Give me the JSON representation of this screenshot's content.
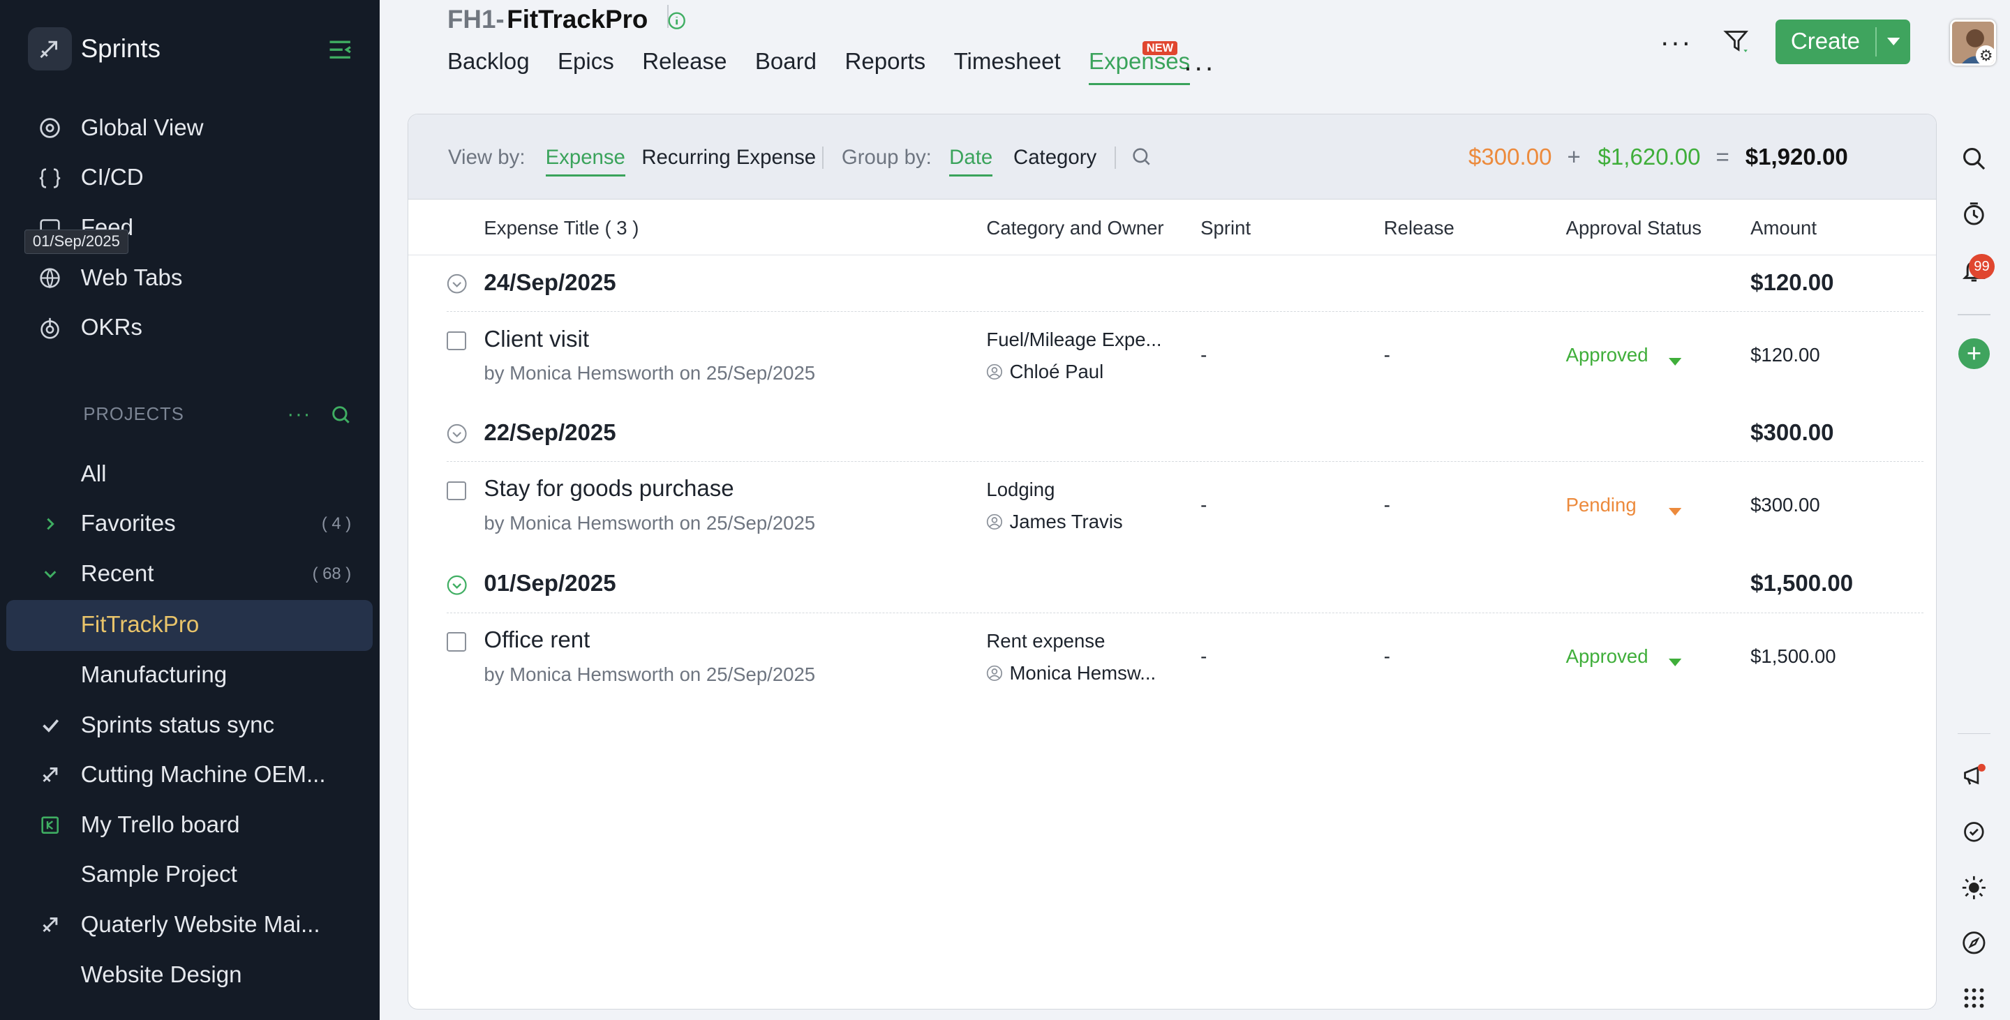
{
  "sidebar": {
    "app_name": "Sprints",
    "tooltip": "01/Sep/2025",
    "nav": [
      {
        "label": "Global View"
      },
      {
        "label": "CI/CD"
      },
      {
        "label": "Feed"
      },
      {
        "label": "Web Tabs"
      },
      {
        "label": "OKRs"
      }
    ],
    "projects_header": "PROJECTS",
    "projects_more": "···",
    "sections": [
      {
        "label": "All"
      },
      {
        "label": "Favorites",
        "count": "( 4 )"
      },
      {
        "label": "Recent",
        "count": "( 68 )"
      }
    ],
    "projects": [
      {
        "label": "FitTrackPro"
      },
      {
        "label": "Manufacturing"
      },
      {
        "label": "Sprints status sync"
      },
      {
        "label": "Cutting Machine OEM..."
      },
      {
        "label": "My Trello board"
      },
      {
        "label": "Sample Project"
      },
      {
        "label": "Quaterly Website Mai..."
      },
      {
        "label": "Website Design"
      }
    ]
  },
  "header": {
    "project_code": "FH1-",
    "project_name": "FitTrackPro",
    "tabs": [
      {
        "label": "Backlog"
      },
      {
        "label": "Epics"
      },
      {
        "label": "Release"
      },
      {
        "label": "Board"
      },
      {
        "label": "Reports"
      },
      {
        "label": "Timesheet"
      },
      {
        "label": "Expenses",
        "badge": "NEW"
      }
    ],
    "more": "···",
    "create_label": "Create"
  },
  "rail": {
    "notification_count": "99"
  },
  "toolbar": {
    "view_by_label": "View by:",
    "view_expense": "Expense",
    "view_recurring": "Recurring Expense",
    "group_by_label": "Group by:",
    "group_date": "Date",
    "group_category": "Category",
    "total_pending": "$300.00",
    "plus": "+",
    "total_approved": "$1,620.00",
    "equals": "=",
    "total_all": "$1,920.00"
  },
  "columns": {
    "title": "Expense Title ( 3 )",
    "category_owner": "Category and Owner",
    "sprint": "Sprint",
    "release": "Release",
    "approval": "Approval Status",
    "amount": "Amount"
  },
  "groups": [
    {
      "date": "24/Sep/2025",
      "total": "$120.00",
      "expense": {
        "title": "Client visit",
        "by": "by",
        "creator": "Monica Hemsworth",
        "on": "on",
        "created": "25/Sep/2025",
        "category": "Fuel/Mileage Expe...",
        "owner": "Chloé Paul",
        "sprint": "-",
        "release": "-",
        "status": "Approved",
        "amount": "$120.00"
      }
    },
    {
      "date": "22/Sep/2025",
      "total": "$300.00",
      "expense": {
        "title": "Stay for goods purchase",
        "by": "by",
        "creator": "Monica Hemsworth",
        "on": "on",
        "created": "25/Sep/2025",
        "category": "Lodging",
        "owner": "James Travis",
        "sprint": "-",
        "release": "-",
        "status": "Pending",
        "amount": "$300.00"
      }
    },
    {
      "date": "01/Sep/2025",
      "total": "$1,500.00",
      "expense": {
        "title": "Office rent",
        "by": "by",
        "creator": "Monica Hemsworth",
        "on": "on",
        "created": "25/Sep/2025",
        "category": "Rent expense",
        "owner": "Monica Hemsw...",
        "sprint": "-",
        "release": "-",
        "status": "Approved",
        "amount": "$1,500.00"
      }
    }
  ],
  "colors": {
    "accent_green": "#3aa35b",
    "approved": "#3fae3a",
    "pending": "#ec8a3c",
    "sidebar_bg": "#141b26"
  }
}
